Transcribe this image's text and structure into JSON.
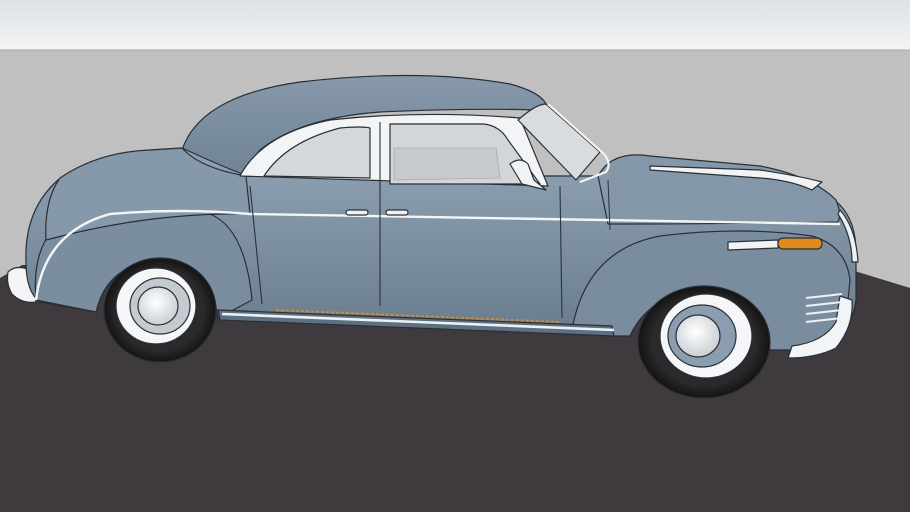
{
  "scene": {
    "subject": "vintage-coupe-3d-model",
    "colors": {
      "sky_top": "#e4e7ea",
      "sky_bottom": "#f2f3f4",
      "ground": "#bfbfbf",
      "shadow_pad": "#3f3b3e",
      "body": "#7d91a3",
      "body_dark": "#5f7384",
      "body_light": "#9aaebe",
      "window": "#d3d7da",
      "chrome": "#f4f6f8",
      "tire": "#1d1d1f",
      "hubcap": "#dfe3e6",
      "amber": "#e08a1c",
      "outline": "#2a2f35"
    }
  }
}
